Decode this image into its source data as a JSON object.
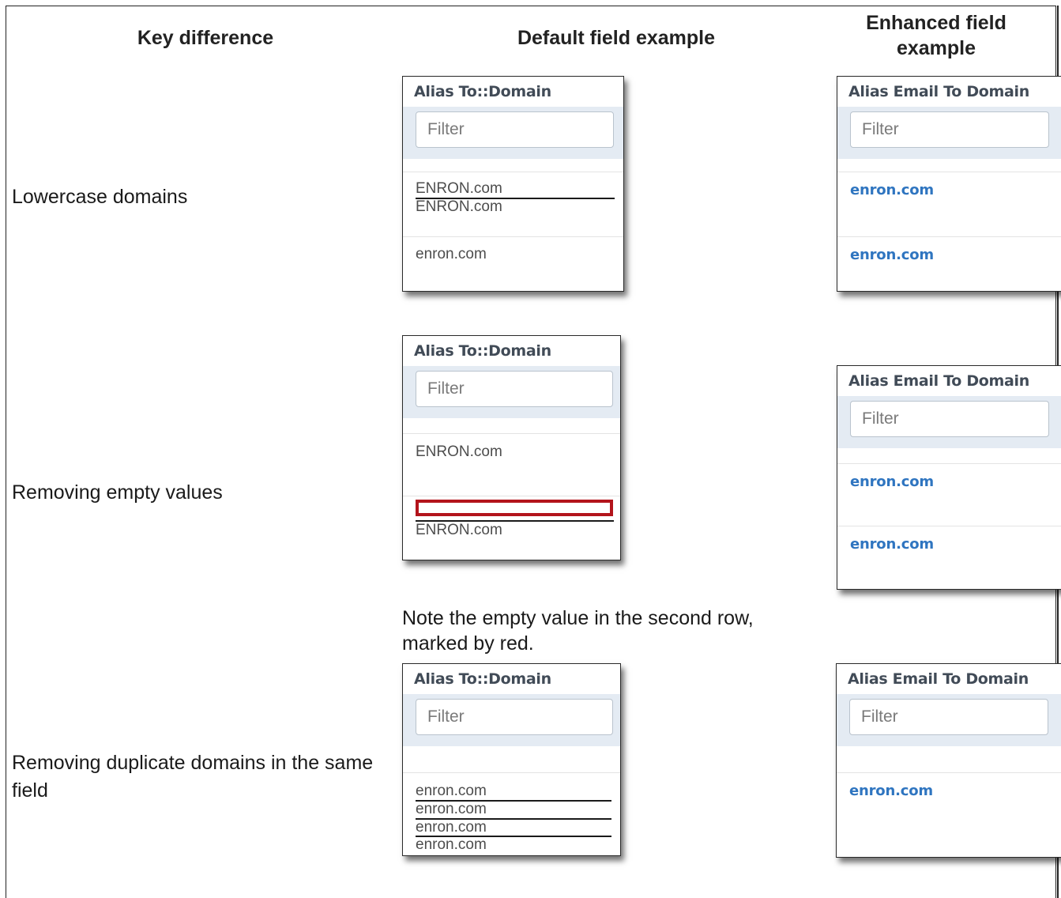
{
  "headers": {
    "key_difference": "Key difference",
    "default_field": "Default field example",
    "enhanced_field": "Enhanced field example"
  },
  "rows": [
    {
      "label": "Lowercase domains",
      "default": {
        "title": "Alias To::Domain",
        "filter_placeholder": "Filter",
        "values": [
          "ENRON.com",
          "ENRON.com",
          "enron.com"
        ]
      },
      "enhanced": {
        "title": "Alias Email To Domain",
        "filter_placeholder": "Filter",
        "values": [
          "enron.com",
          "enron.com"
        ]
      }
    },
    {
      "label": "Removing empty values",
      "default": {
        "title": "Alias To::Domain",
        "filter_placeholder": "Filter",
        "values": [
          "ENRON.com",
          "ENRON.com"
        ]
      },
      "enhanced": {
        "title": "Alias Email To Domain",
        "filter_placeholder": "Filter",
        "values": [
          "enron.com",
          "enron.com"
        ]
      },
      "note": "Note the empty value in the second row, marked by red."
    },
    {
      "label": "Removing duplicate domains in the same field",
      "default": {
        "title": "Alias To::Domain",
        "filter_placeholder": "Filter",
        "values": [
          "enron.com",
          "enron.com",
          "enron.com",
          "enron.com"
        ]
      },
      "enhanced": {
        "title": "Alias Email To Domain",
        "filter_placeholder": "Filter",
        "values": [
          "enron.com"
        ]
      }
    }
  ],
  "colors": {
    "link": "#2f75c0",
    "highlight_red": "#b3141b",
    "filter_band": "#e4ebf3"
  }
}
